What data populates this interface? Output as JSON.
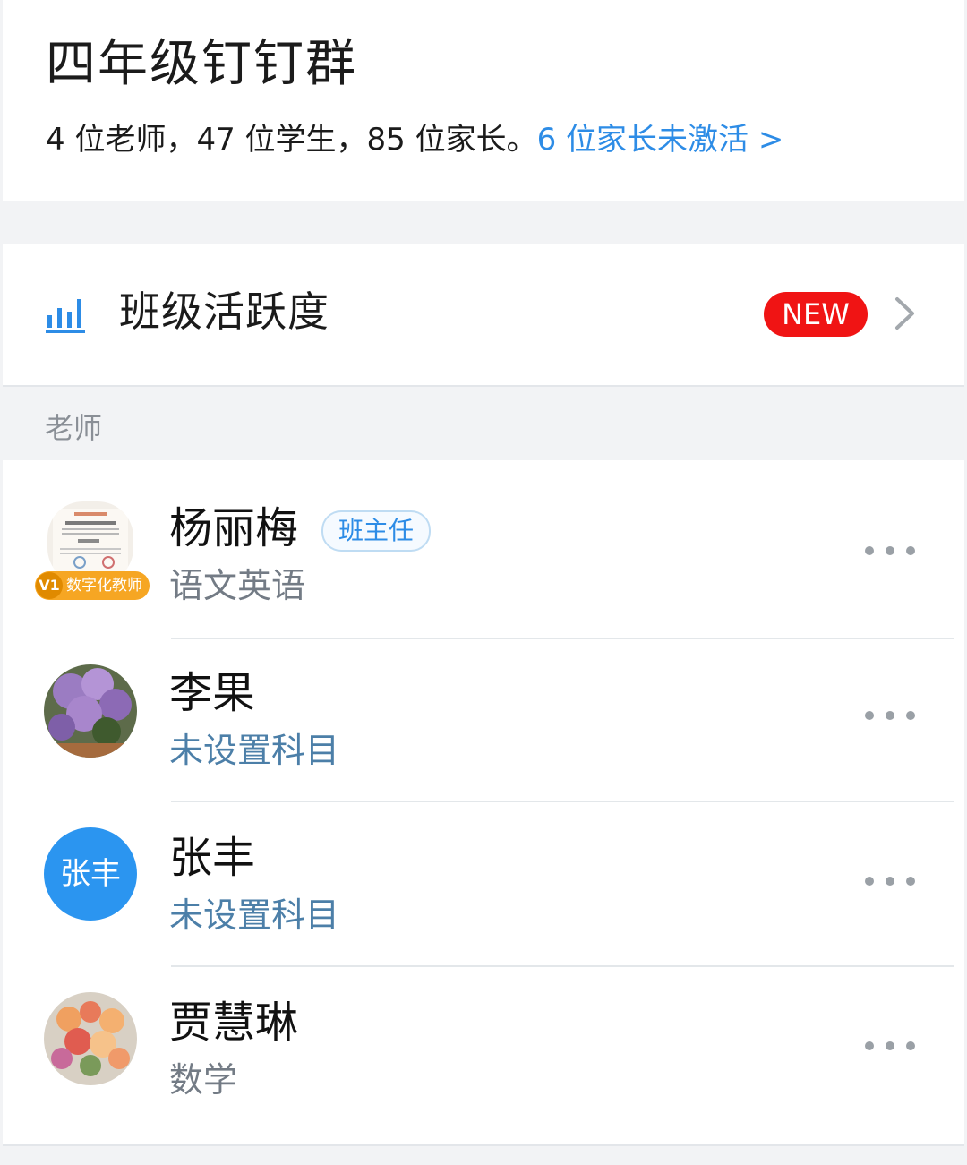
{
  "header": {
    "group_name": "四年级钉钉群",
    "stats_text": "4 位老师，47 位学生，85 位家长。",
    "inactive_link": "6 位家长未激活 >"
  },
  "activity": {
    "label": "班级活跃度",
    "badge": "NEW",
    "icon": "bar-chart-icon"
  },
  "section": {
    "teachers_label": "老师"
  },
  "teachers": [
    {
      "name": "杨丽梅",
      "role_tag": "班主任",
      "subject": "语文英语",
      "avatar_type": "certificate-image",
      "badge_level": "V1",
      "badge_text": "数字化教师"
    },
    {
      "name": "李果",
      "subject": "未设置科目",
      "avatar_type": "lilac-photo"
    },
    {
      "name": "张丰",
      "subject": "未设置科目",
      "avatar_type": "initials",
      "avatar_text": "张丰"
    },
    {
      "name": "贾慧琳",
      "subject": "数学",
      "avatar_type": "flower-bouquet-photo"
    }
  ],
  "colors": {
    "link_blue": "#2d8ce6",
    "badge_red": "#f01414",
    "avatar_blue": "#2b95f0",
    "digital_badge_orange": "#f6a623"
  }
}
